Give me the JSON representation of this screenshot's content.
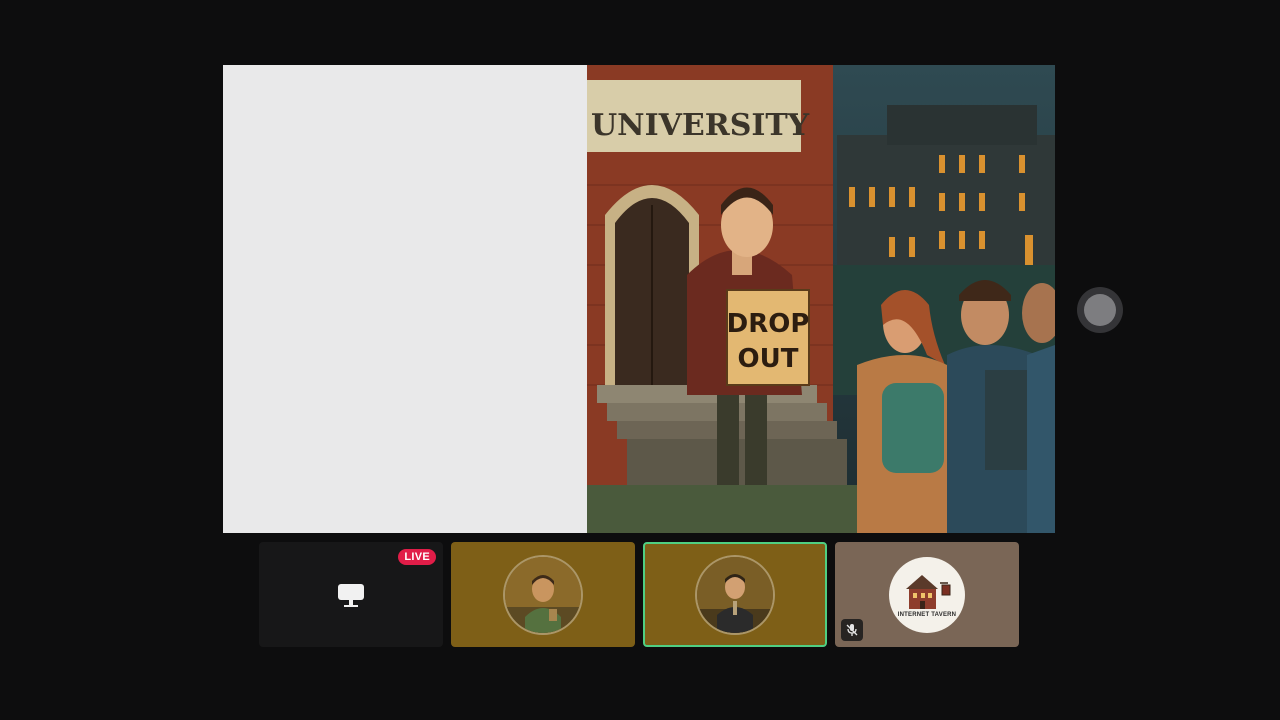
{
  "stage": {
    "scene": {
      "building_sign": "UNIVERSITY",
      "sign_line_1": "DROP",
      "sign_line_2": "OUT"
    }
  },
  "tiles": [
    {
      "type": "screen-share",
      "badge": "LIVE",
      "icon": "monitor-icon"
    },
    {
      "type": "participant",
      "icon": "avatar"
    },
    {
      "type": "participant",
      "active_speaker": true,
      "icon": "avatar"
    },
    {
      "type": "participant",
      "logo_text": "INTERNET TAVERN",
      "icon": "mic-muted-icon"
    }
  ],
  "colors": {
    "background": "#0d0d0e",
    "live_badge": "#e11d48",
    "active_border": "#4fcf82",
    "tile_brown": "#7e5f17",
    "tile_logo": "#7a6656"
  }
}
